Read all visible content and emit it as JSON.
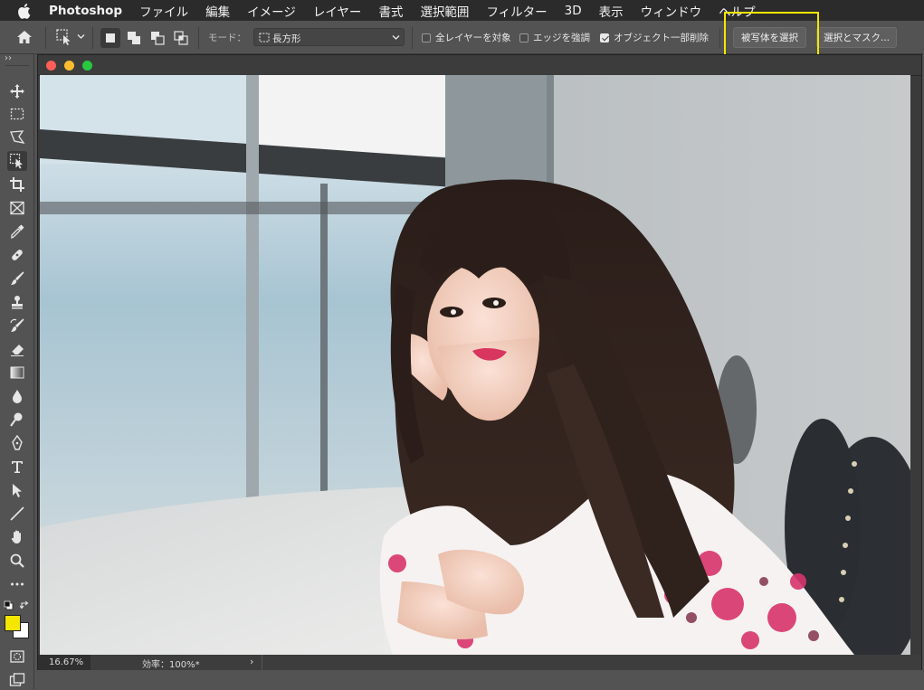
{
  "menubar": {
    "app_name": "Photoshop",
    "items": [
      "ファイル",
      "編集",
      "イメージ",
      "レイヤー",
      "書式",
      "選択範囲",
      "フィルター",
      "3D",
      "表示",
      "ウィンドウ",
      "ヘルプ"
    ]
  },
  "options": {
    "mode_label": "モード：",
    "mode_value": "長方形",
    "sample_all_layers": {
      "label": "全レイヤーを対象",
      "checked": false
    },
    "enhance_edge": {
      "label": "エッジを強調",
      "checked": false
    },
    "object_subtract": {
      "label": "オブジェクト一部削除",
      "checked": true
    },
    "select_subject_label": "被写体を選択",
    "select_and_mask_label": "選択とマスク..."
  },
  "toolbar": {
    "expand_glyph": "››",
    "tools": [
      "move-tool",
      "marquee-tool",
      "lasso-tool",
      "object-selection-tool",
      "crop-tool",
      "frame-tool",
      "eyedropper-tool",
      "healing-brush-tool",
      "brush-tool",
      "clone-stamp-tool",
      "history-brush-tool",
      "eraser-tool",
      "gradient-tool",
      "blur-tool",
      "dodge-tool",
      "pen-tool",
      "type-tool",
      "path-selection-tool",
      "line-tool",
      "hand-tool",
      "zoom-tool",
      "more-tools"
    ],
    "foreground_color": "#f5e600",
    "background_color": "#ffffff"
  },
  "document": {
    "zoom": "16.67%",
    "efficiency": "効率：100%*",
    "status_arrow": "›"
  },
  "colors": {
    "highlight": "#f5e600",
    "traffic_close": "#ff5f57",
    "traffic_min": "#febc2e",
    "traffic_max": "#28c840"
  }
}
